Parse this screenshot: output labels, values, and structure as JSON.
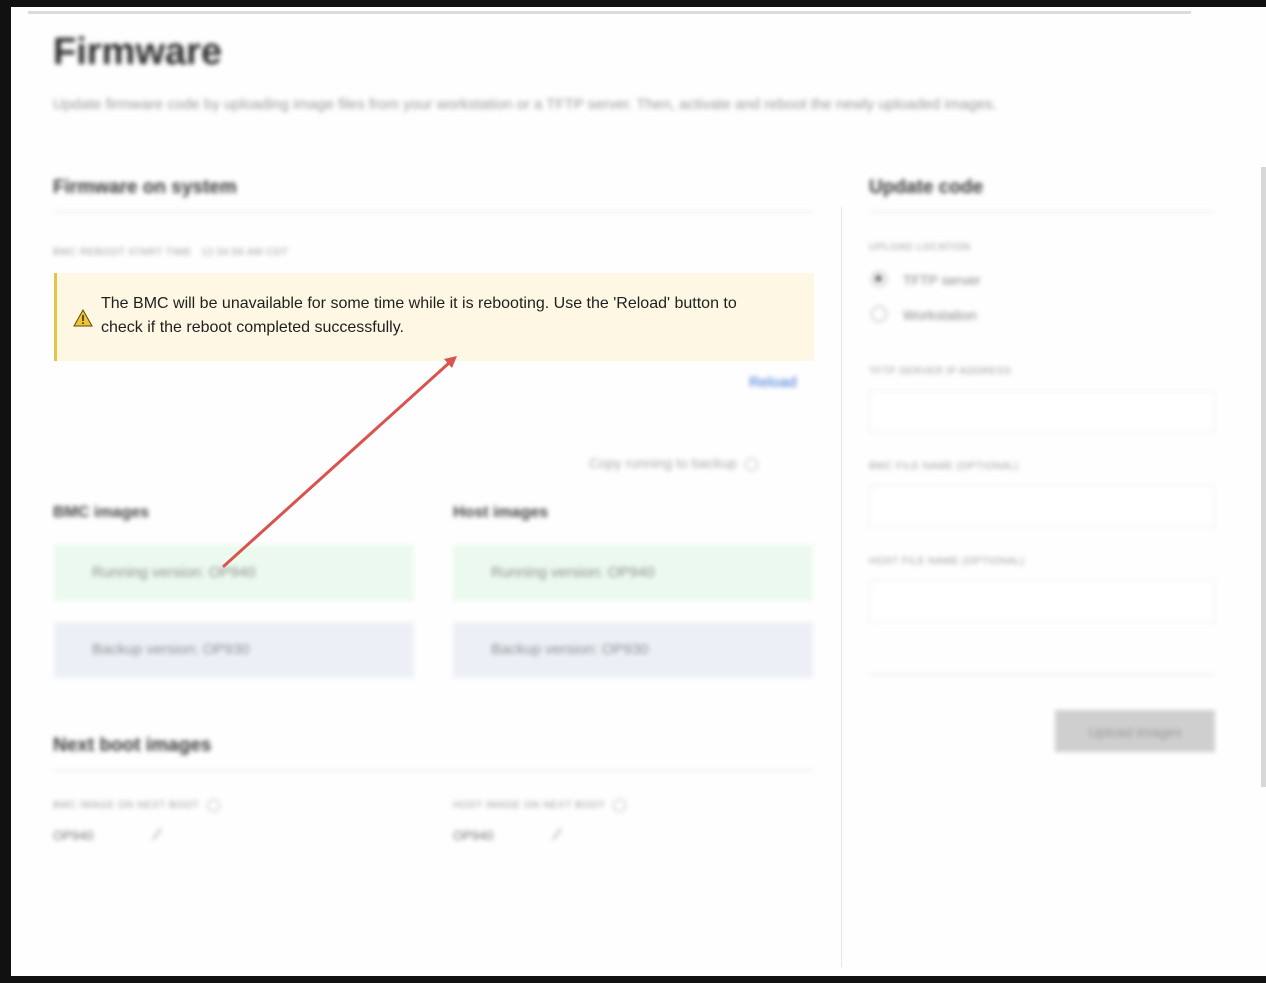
{
  "page": {
    "title": "Firmware",
    "description": "Update firmware code by uploading image files from your workstation or a TFTP server. Then, activate and reboot the newly uploaded images."
  },
  "firmware_on_system": {
    "title": "Firmware on system",
    "reboot_label": "BMC reboot start time",
    "reboot_value": "12:34:56 AM CDT",
    "alert": {
      "icon": "warning-icon",
      "text": "The BMC will be unavailable for some time while it is rebooting. Use the 'Reload' button to check if the reboot completed successfully."
    },
    "reload_label": "Reload",
    "copy_label": "Copy running to backup",
    "bmc": {
      "title": "BMC images",
      "running": "Running version: OP940",
      "backup": "Backup version: OP930"
    },
    "host": {
      "title": "Host images",
      "running": "Running version: OP940",
      "backup": "Backup version: OP930"
    }
  },
  "next_boot": {
    "title": "Next boot images",
    "bmc_label": "BMC image on next boot",
    "bmc_value": "OP940",
    "host_label": "Host image on next boot",
    "host_value": "OP940"
  },
  "update_code": {
    "title": "Update code",
    "location_label": "Upload location",
    "options": [
      "TFTP server",
      "Workstation"
    ],
    "selected": "TFTP server",
    "tftp_label": "TFTP server IP address",
    "bmc_file_label": "BMC file name (optional)",
    "host_file_label": "Host file name (optional)",
    "upload_button": "Upload images"
  },
  "colors": {
    "annotation_arrow": "#d9534f",
    "alert_bg": "#fdf7e4",
    "alert_border": "#e8c34a",
    "link": "#3b74d8"
  }
}
